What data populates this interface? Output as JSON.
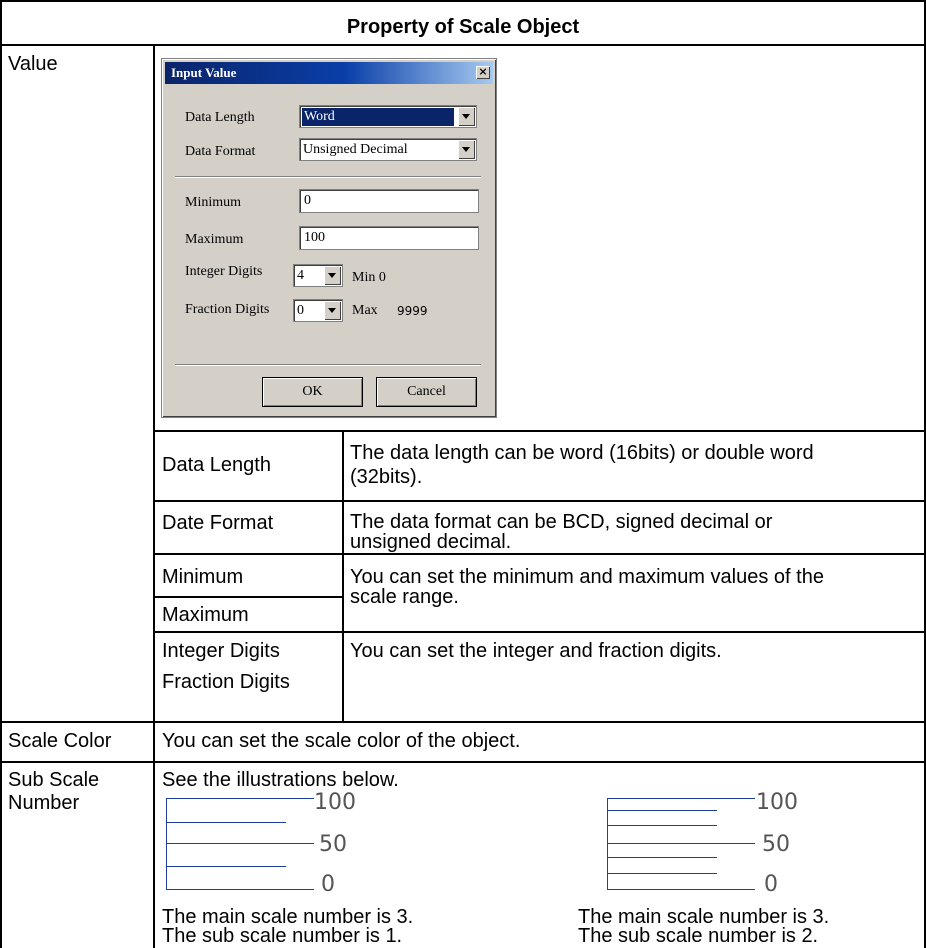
{
  "header": "Property of Scale Object",
  "rows": {
    "value": "Value",
    "scale_color": "Scale Color",
    "sub_scale": [
      "Sub Scale",
      "Number"
    ]
  },
  "dialog": {
    "title": "Input Value",
    "close_glyph": "×",
    "data_length_label": "Data Length",
    "data_length_value": "Word",
    "data_format_label": "Data Format",
    "data_format_value": "Unsigned Decimal",
    "minimum_label": "Minimum",
    "minimum_value": "0",
    "maximum_label": "Maximum",
    "maximum_value": "100",
    "integer_digits_label": "Integer Digits",
    "integer_digits_value": "4",
    "fraction_digits_label": "Fraction Digits",
    "fraction_digits_value": "0",
    "min_text": "Min 0",
    "max_label": "Max",
    "max_value": "9999",
    "ok_label": "OK",
    "cancel_label": "Cancel"
  },
  "fields": {
    "data_length": {
      "name": "Data Length",
      "desc": [
        "The data length can be word (16bits) or double word",
        "(32bits)."
      ]
    },
    "date_format": {
      "name": "Date Format",
      "desc": [
        "The data format can be BCD, signed decimal or",
        "unsigned decimal."
      ]
    },
    "minimum": {
      "name": "Minimum"
    },
    "maximum": {
      "name": "Maximum"
    },
    "minmax_desc": [
      "You can set the minimum and maximum values of the",
      "scale range."
    ],
    "integer_digits": {
      "name": "Integer Digits"
    },
    "fraction_digits": {
      "name": "Fraction Digits"
    },
    "digits_desc": "You can set the integer and fraction digits."
  },
  "scale_color_desc": "You can set the scale color of the object.",
  "sub_scale": {
    "intro": "See the illustrations below.",
    "scale_labels": [
      "100",
      "50",
      "0"
    ],
    "left_caption": [
      "The main scale number is 3.",
      "The sub scale number is 1."
    ],
    "right_caption": [
      "The main scale number is 3.",
      "The sub scale number is 2."
    ]
  },
  "colors": {
    "scale_line": "#1f3f9e",
    "title_bar": "#0a246a",
    "dialog_bg": "#d4d0c8"
  }
}
